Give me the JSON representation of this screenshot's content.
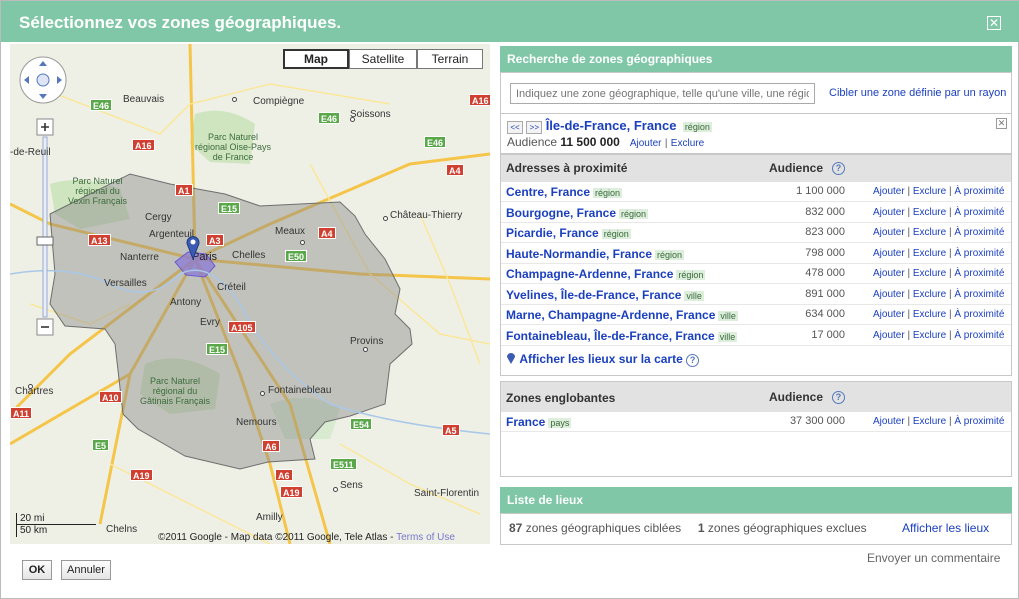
{
  "dialog": {
    "title": "Sélectionnez vos zones géographiques.",
    "close_icon": "✕"
  },
  "map": {
    "types": [
      "Map",
      "Satellite",
      "Terrain"
    ],
    "active_type": "Map",
    "scale_mi": "20 mi",
    "scale_km": "50 km",
    "copyright": "©2011 Google - Map data ©2011 Google, Tele Atlas -",
    "terms": "Terms of Use",
    "towns": {
      "beauvais": "Beauvais",
      "compiegne": "Compiègne",
      "soissons": "Soissons",
      "cergy": "Cergy",
      "argenteuil": "Argenteuil",
      "nanterre": "Nanterre",
      "paris": "Paris",
      "chelles": "Chelles",
      "meaux": "Meaux",
      "chateau_thierry": "Château-Thierry",
      "versailles": "Versailles",
      "creteil": "Créteil",
      "antony": "Antony",
      "evry": "Evry",
      "provins": "Provins",
      "chartres": "Chartres",
      "fontainebleau": "Fontainebleau",
      "nemours": "Nemours",
      "sens": "Sens",
      "saint_florentin": "Saint-Florentin",
      "amilly": "Amilly",
      "dreux": "-de-Reuil",
      "chelns": "Chelns"
    },
    "parks": {
      "oise": "Parc Naturel\nrégional Oise-Pays\nde France",
      "vexin": "Parc Naturel\nrégional du\nVexin Français",
      "gatinais": "Parc Naturel\nrégional du\nGâtinais Français"
    },
    "roads": [
      "E46",
      "A16",
      "A1",
      "E46",
      "E46",
      "A4",
      "A16",
      "E15",
      "E50",
      "A13",
      "A3",
      "A4",
      "A105",
      "E15",
      "A10",
      "A6",
      "E54",
      "A5",
      "E5",
      "A19",
      "A6",
      "E511",
      "A19",
      "A11"
    ]
  },
  "search": {
    "header": "Recherche de zones géographiques",
    "placeholder": "Indiquez une zone géographique, telle qu'une ville, une région",
    "radius_link": "Cibler une zone définie par un rayon"
  },
  "current": {
    "prev": "<<",
    "next": ">>",
    "name": "Île-de-France, France",
    "type": "région",
    "audience_label": "Audience",
    "audience_value": "11 500 000",
    "include": "Ajouter",
    "exclude": "Exclure",
    "remove_icon": "✕"
  },
  "nearby": {
    "header": "Adresses à proximité",
    "audience_header": "Audience",
    "rows": [
      {
        "name": "Centre, France",
        "type": "région",
        "audience": "1 100 000"
      },
      {
        "name": "Bourgogne, France",
        "type": "région",
        "audience": "832 000"
      },
      {
        "name": "Picardie, France",
        "type": "région",
        "audience": "823 000"
      },
      {
        "name": "Haute-Normandie, France",
        "type": "région",
        "audience": "798 000"
      },
      {
        "name": "Champagne-Ardenne, France",
        "type": "région",
        "audience": "478 000"
      },
      {
        "name": "Yvelines, Île-de-France, France",
        "type": "ville",
        "audience": "891 000"
      },
      {
        "name": "Marne, Champagne-Ardenne, France",
        "type": "ville",
        "audience": "634 000"
      },
      {
        "name": "Fontainebleau, Île-de-France, France",
        "type": "ville",
        "audience": "17 000"
      }
    ],
    "actions": {
      "add": "Ajouter",
      "exclude": "Exclure",
      "nearby": "À proximité"
    },
    "show_on_map": "Afficher les lieux sur la carte"
  },
  "enclosing": {
    "header": "Zones englobantes",
    "audience_header": "Audience",
    "rows": [
      {
        "name": "France",
        "type": "pays",
        "audience": "37 300 000"
      }
    ]
  },
  "places": {
    "header": "Liste de lieux",
    "targeted_count": "87",
    "targeted_label": "zones géographiques ciblées",
    "excluded_count": "1",
    "excluded_label": "zones géographiques exclues",
    "show_link": "Afficher les lieux"
  },
  "footer": {
    "feedback": "Envoyer un commentaire",
    "ok": "OK",
    "cancel": "Annuler"
  },
  "colors": {
    "header_green": "#7fc7a6",
    "link_blue": "#1a3fbf",
    "region_fill": "#8a8a8a"
  }
}
